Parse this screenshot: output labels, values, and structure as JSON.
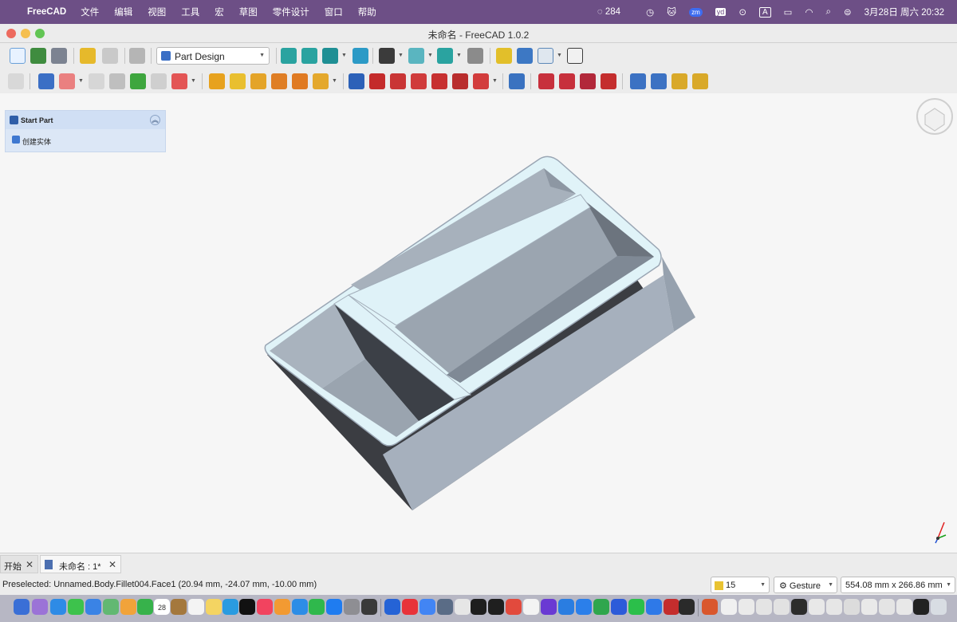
{
  "menubar": {
    "app_name": "FreeCAD",
    "items": [
      "文件",
      "编辑",
      "视图",
      "工具",
      "宏",
      "草图",
      "零件设计",
      "窗口",
      "帮助"
    ],
    "notif_count": "284",
    "zoom_label": "zm",
    "youdao_label": "yd",
    "input_label": "A",
    "datetime": "3月28日 周六  20:32"
  },
  "window": {
    "title": "未命名 - FreeCAD 1.0.2"
  },
  "toolbar": {
    "workbench": "Part Design"
  },
  "task_panel": {
    "title": "Start Part",
    "action": "创建实体"
  },
  "tabs": [
    {
      "label": "开始"
    },
    {
      "label": "未命名 : 1*"
    }
  ],
  "status": {
    "preselected": "Preselected: Unnamed.Body.Fillet004.Face1 (20.94 mm, -24.07 mm, -10.00 mm)",
    "nav_value": "15",
    "nav_style": "Gesture",
    "dimensions": "554.08 mm x 266.86 mm"
  },
  "dock": {
    "calendar_day": "28"
  }
}
